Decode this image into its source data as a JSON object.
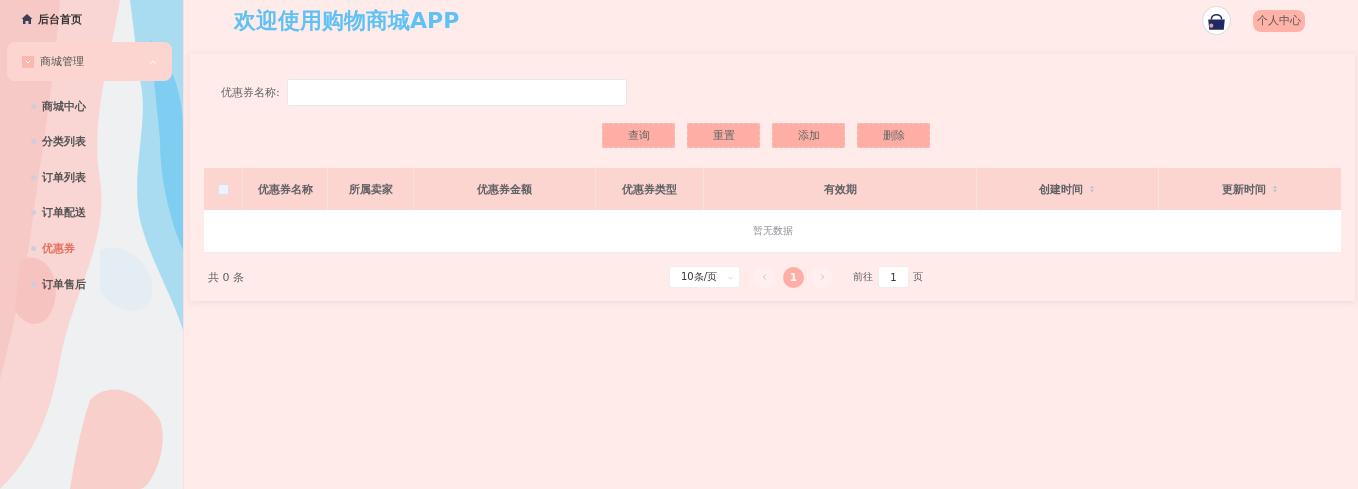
{
  "sidebar": {
    "items": [
      {
        "kind": "link",
        "label": "后台首页"
      },
      {
        "kind": "group",
        "label": "商城管理",
        "expanded": true,
        "children": [
          {
            "label": "商城中心",
            "selected": false
          },
          {
            "label": "分类列表",
            "selected": false
          },
          {
            "label": "订单列表",
            "selected": false
          },
          {
            "label": "订单配送",
            "selected": false
          },
          {
            "label": "优惠券",
            "selected": true
          },
          {
            "label": "订单售后",
            "selected": false
          }
        ]
      }
    ]
  },
  "header": {
    "title": "欢迎使用购物商城APP",
    "profile_button": "个人中心"
  },
  "search": {
    "label": "优惠券名称:"
  },
  "buttons": [
    "查询",
    "重置",
    "添加",
    "删除"
  ],
  "table": {
    "select_all_checked": false,
    "columns": [
      {
        "label": "优惠券名称",
        "sortable": false
      },
      {
        "label": "所属卖家",
        "sortable": false
      },
      {
        "label": "优惠券金额",
        "sortable": false
      },
      {
        "label": "优惠券类型",
        "sortable": false
      },
      {
        "label": "有效期",
        "sortable": false
      },
      {
        "label": "创建时间",
        "sortable": true
      },
      {
        "label": "更新时间",
        "sortable": true
      }
    ],
    "empty_text": "暂无数据"
  },
  "pagination": {
    "total": "共 0 条",
    "page_size": "10条/页",
    "pages": [
      {
        "label": "1",
        "selected": true
      }
    ],
    "goto_label": "前往",
    "goto_value": "1",
    "goto_suffix": "页"
  }
}
